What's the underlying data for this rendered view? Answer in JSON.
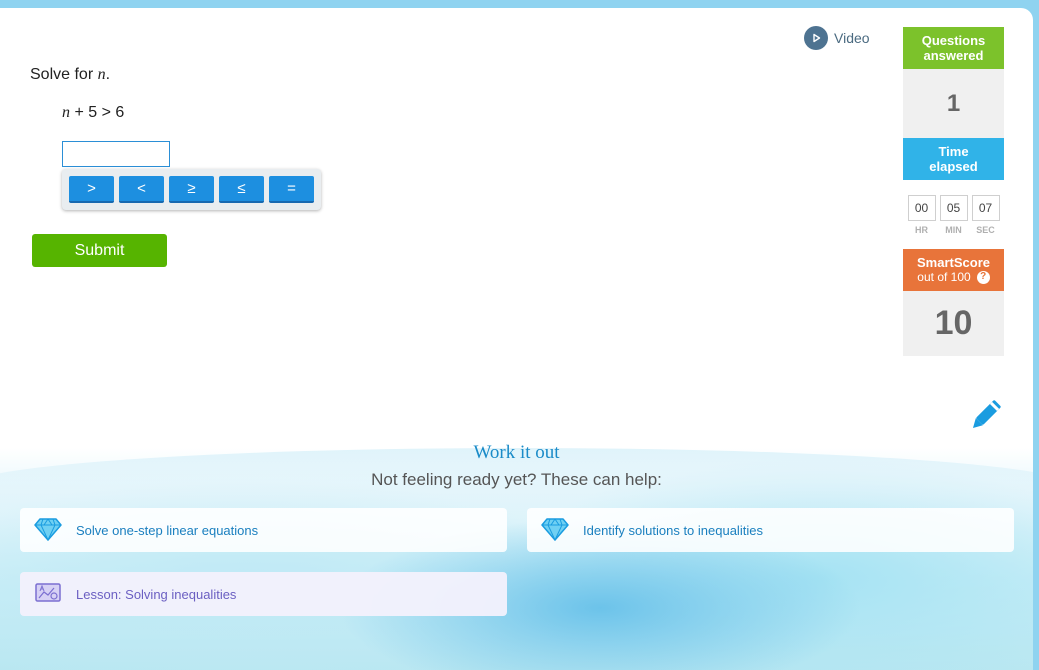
{
  "video": {
    "label": "Video",
    "icon": "play-icon"
  },
  "question": {
    "prompt_prefix": "Solve for ",
    "variable": "n",
    "prompt_suffix": ".",
    "expression_var": "n",
    "expression_rest": " + 5 > 6",
    "input_value": ""
  },
  "keypad": {
    "keys": [
      ">",
      "<",
      "≥",
      "≤",
      "="
    ]
  },
  "submit_label": "Submit",
  "stats": {
    "questions_label_1": "Questions",
    "questions_label_2": "answered",
    "questions_value": "1",
    "time_label_1": "Time",
    "time_label_2": "elapsed",
    "time_hr": "00",
    "time_min": "05",
    "time_sec": "07",
    "hr_label": "HR",
    "min_label": "MIN",
    "sec_label": "SEC",
    "smartscore_label": "SmartScore",
    "smartscore_sub": "out of 100",
    "smartscore_help": "?",
    "smartscore_value": "10"
  },
  "help": {
    "title": "Work it out",
    "subtitle": "Not feeling ready yet? These can help:",
    "items": [
      {
        "label": "Solve one-step linear equations",
        "icon": "diamond-icon"
      },
      {
        "label": "Identify solutions to inequalities",
        "icon": "diamond-icon"
      },
      {
        "label": "Lesson: Solving inequalities",
        "icon": "lesson-board-icon"
      }
    ]
  },
  "colors": {
    "accent_blue": "#1d8fe0",
    "submit_green": "#56b400",
    "questions_green": "#7cc22b",
    "time_blue": "#30b3e8",
    "smartscore_orange": "#e8743a"
  }
}
